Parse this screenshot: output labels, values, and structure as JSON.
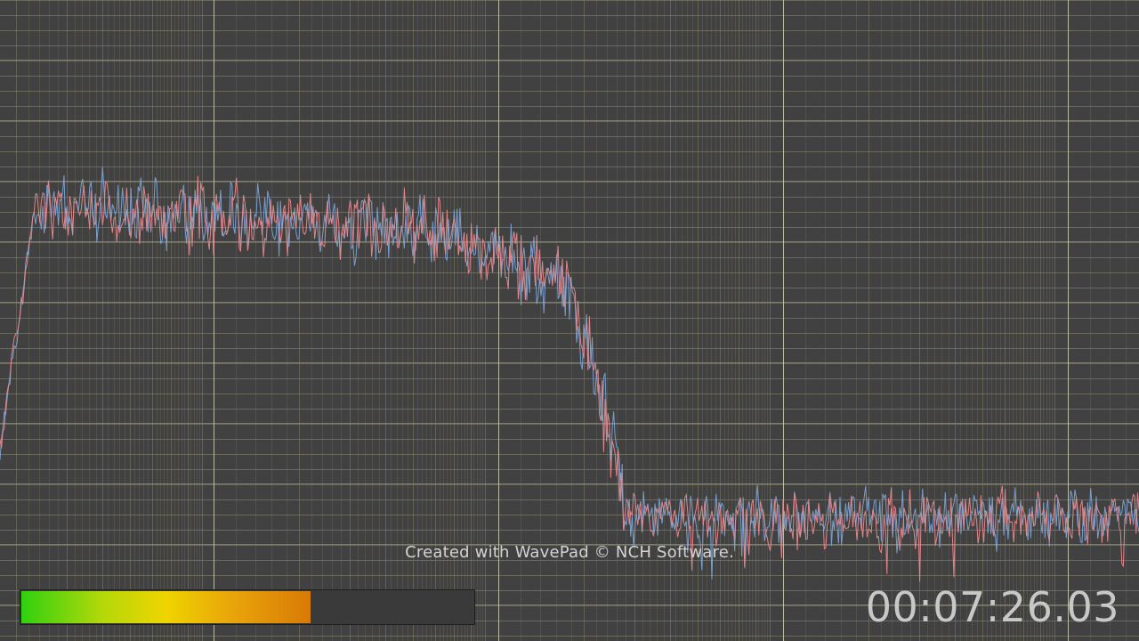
{
  "watermark": "Created with WavePad © NCH Software.",
  "time_display": "00:07:26.03",
  "level_meter": {
    "level": 0.64
  },
  "colors": {
    "background": "#414141",
    "grid_minor": "#8c8a72",
    "grid_major": "#c8c8b0",
    "channel_left": "#e68a8e",
    "channel_right": "#7fa8dc"
  }
}
